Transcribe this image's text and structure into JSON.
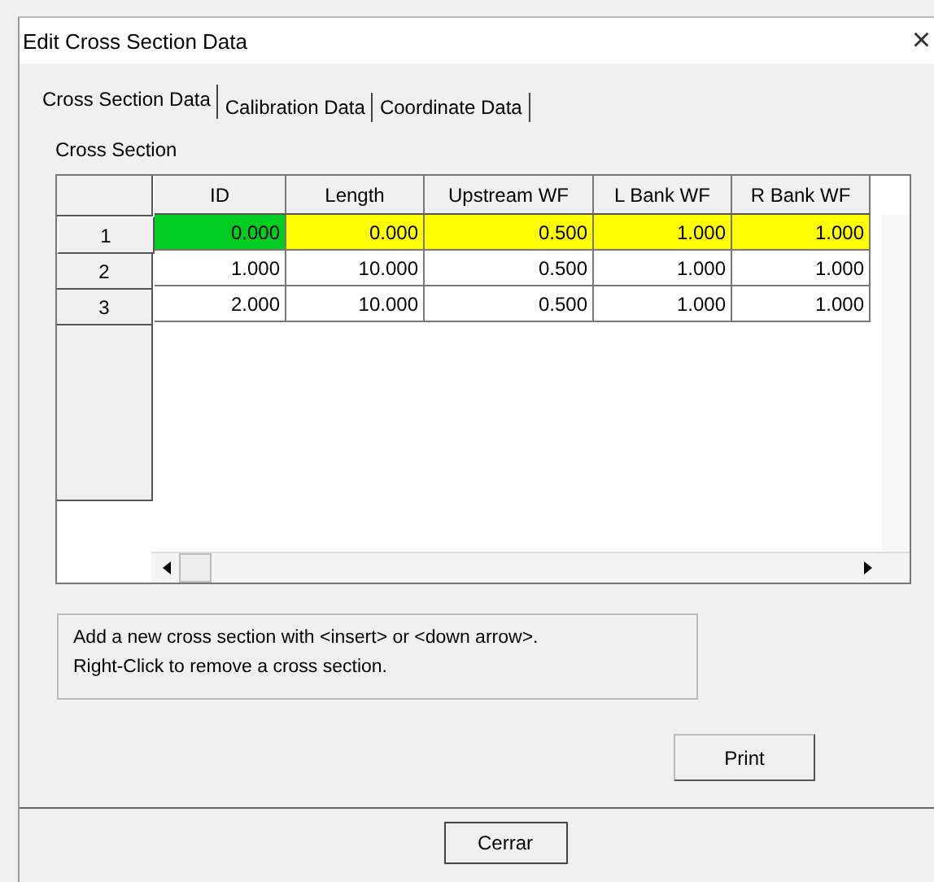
{
  "window": {
    "title": "Edit Cross Section Data",
    "close": "×"
  },
  "tabs": [
    {
      "label": "Cross Section Data",
      "selected": true
    },
    {
      "label": "Calibration Data",
      "selected": false
    },
    {
      "label": "Coordinate Data",
      "selected": false
    }
  ],
  "group_label": "Cross Section",
  "table": {
    "columns": [
      "ID",
      "Length",
      "Upstream WF",
      "L Bank WF",
      "R Bank WF"
    ],
    "rows": [
      {
        "header": "1",
        "selected": true,
        "cells": [
          {
            "text": "0.000",
            "focused": true
          },
          {
            "text": "0.000",
            "focused": false
          },
          {
            "text": "0.500",
            "focused": false
          },
          {
            "text": "1.000",
            "focused": false
          },
          {
            "text": "1.000",
            "focused": false
          }
        ]
      },
      {
        "header": "2",
        "selected": false,
        "cells": [
          {
            "text": "1.000",
            "focused": false
          },
          {
            "text": "10.000",
            "focused": false
          },
          {
            "text": "0.500",
            "focused": false
          },
          {
            "text": "1.000",
            "focused": false
          },
          {
            "text": "1.000",
            "focused": false
          }
        ]
      },
      {
        "header": "3",
        "selected": false,
        "cells": [
          {
            "text": "2.000",
            "focused": false
          },
          {
            "text": "10.000",
            "focused": false
          },
          {
            "text": "0.500",
            "focused": false
          },
          {
            "text": "1.000",
            "focused": false
          },
          {
            "text": "1.000",
            "focused": false
          }
        ]
      }
    ]
  },
  "hint": [
    "Add a new cross section with <insert> or <down arrow>.",
    "Right-Click to remove a cross section."
  ],
  "buttons": {
    "print": "Print",
    "close": "Cerrar"
  }
}
